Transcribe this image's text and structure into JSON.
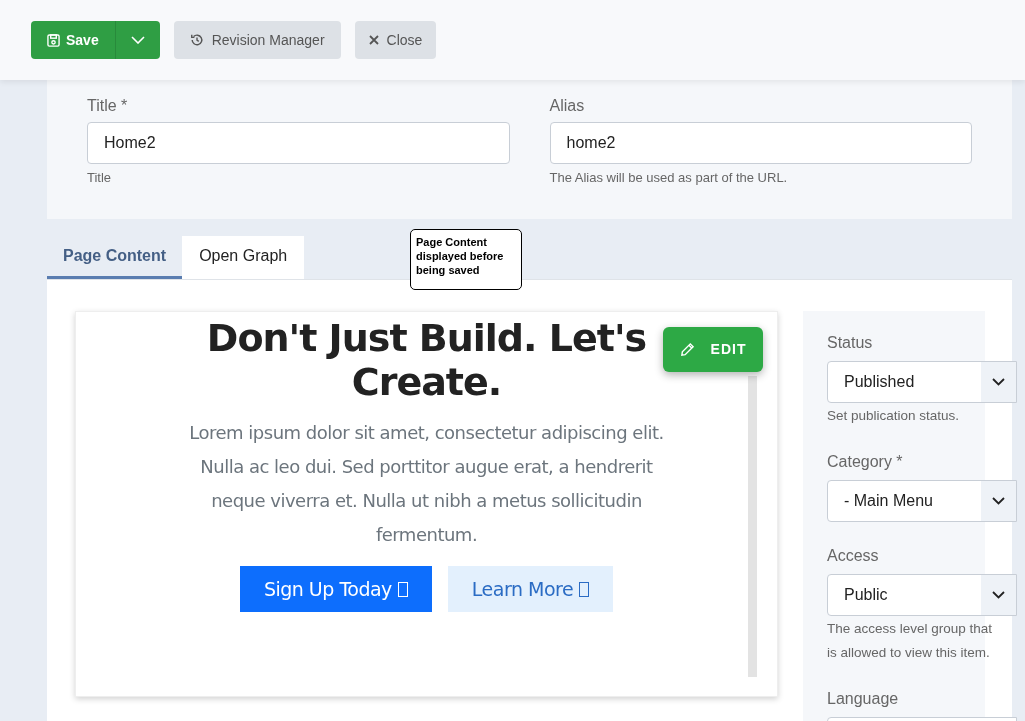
{
  "toolbar": {
    "save": "Save",
    "revision": "Revision Manager",
    "close": "Close"
  },
  "fields": [
    {
      "label": "Title *",
      "value": "Home2",
      "hint": "Title"
    },
    {
      "label": "Alias",
      "value": "home2",
      "hint": "The Alias will be used as part of the URL."
    }
  ],
  "tabs": [
    {
      "label": "Page Content",
      "selected": true
    },
    {
      "label": "Open Graph",
      "selected": false
    }
  ],
  "note": "Page Content displayed before being saved",
  "preview": {
    "heading": "Don't Just Build. Let's Create.",
    "text": "Lorem ipsum dolor sit amet, consectetur adipiscing elit. Nulla ac leo dui. Sed porttitor augue erat, a hendrerit neque viverra et. Nulla ut nibh a metus sollicitudin fermentum.",
    "buttons": [
      {
        "label": "Sign Up Today",
        "kind": "primary"
      },
      {
        "label": "Learn More",
        "kind": "secondary"
      }
    ],
    "edit": "EDIT"
  },
  "sidebar": [
    {
      "label": "Status",
      "value": "Published",
      "hint": "Set publication status."
    },
    {
      "label": "Category *",
      "value": "- Main Menu"
    },
    {
      "label": "Access",
      "value": "Public",
      "hint": "The access level group that is allowed to view this item."
    },
    {
      "label": "Language"
    }
  ]
}
